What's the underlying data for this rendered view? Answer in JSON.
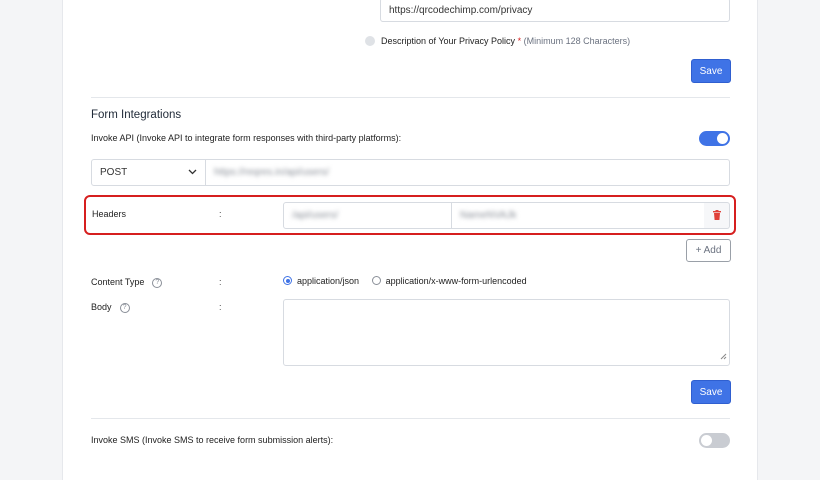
{
  "privacy": {
    "url_value": "https://qrcodechimp.com/privacy",
    "description_label": "Description of Your Privacy Policy",
    "required_mark": "*",
    "description_hint": "(Minimum 128 Characters)",
    "save_label": "Save"
  },
  "form_integrations": {
    "title": "Form Integrations",
    "invoke_api_label": "Invoke API (Invoke API to integrate form responses with third-party platforms):",
    "invoke_api_enabled": true,
    "method_value": "POST",
    "endpoint_value": "https://reqres.in/api/users/",
    "headers_label": "Headers",
    "colon": ":",
    "header_key_value": "/api/users/",
    "header_value_value": "NameNVAJk",
    "add_label": "+ Add",
    "content_type_label": "Content Type",
    "content_type_options": [
      "application/json",
      "application/x-www-form-urlencoded"
    ],
    "content_type_selected": "application/json",
    "body_label": "Body",
    "body_value": "",
    "save_label": "Save",
    "invoke_sms_label": "Invoke SMS (Invoke SMS to receive form submission alerts):",
    "invoke_sms_enabled": false
  },
  "colors": {
    "accent": "#3f73e6",
    "highlight": "#d61f1f",
    "delete_icon": "#e0413a",
    "toggle_off": "#c9ccd2"
  },
  "icons": {
    "help": "?"
  }
}
